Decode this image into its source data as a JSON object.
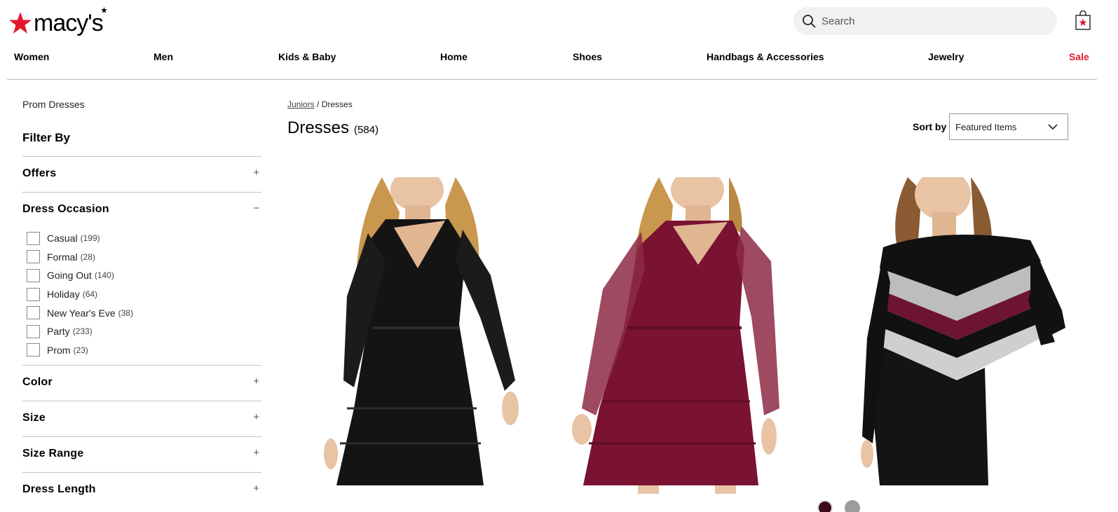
{
  "header": {
    "logo_text": "macy's",
    "search_placeholder": "Search"
  },
  "nav": [
    {
      "label": "Women"
    },
    {
      "label": "Men"
    },
    {
      "label": "Kids & Baby"
    },
    {
      "label": "Home"
    },
    {
      "label": "Shoes"
    },
    {
      "label": "Handbags & Accessories"
    },
    {
      "label": "Jewelry"
    },
    {
      "label": "Sale"
    }
  ],
  "sidebar": {
    "prom_link": "Prom Dresses",
    "filter_title": "Filter By",
    "facets": [
      {
        "title": "Offers",
        "toggle": "+"
      },
      {
        "title": "Dress Occasion",
        "toggle": "−"
      },
      {
        "title": "Color",
        "toggle": "+"
      },
      {
        "title": "Size",
        "toggle": "+"
      },
      {
        "title": "Size Range",
        "toggle": "+"
      },
      {
        "title": "Dress Length",
        "toggle": "+"
      }
    ],
    "occasion_options": [
      {
        "label": "Casual",
        "count": "(199)"
      },
      {
        "label": "Formal",
        "count": "(28)"
      },
      {
        "label": "Going Out",
        "count": "(140)"
      },
      {
        "label": "Holiday",
        "count": "(64)"
      },
      {
        "label": "New Year's Eve",
        "count": "(38)"
      },
      {
        "label": "Party",
        "count": "(233)"
      },
      {
        "label": "Prom",
        "count": "(23)"
      }
    ]
  },
  "main": {
    "breadcrumb": {
      "parent": "Juniors",
      "separator": "/",
      "current": "Dresses"
    },
    "title": "Dresses",
    "count": "(584)",
    "sort_label": "Sort by",
    "sort_value": "Featured Items"
  },
  "colors": {
    "brand_red": "#e21a2c",
    "sale_red": "#e21a2c",
    "search_bg": "#f1f1f1",
    "divider": "#c4c4c4",
    "dress_black": "#141414",
    "dress_burgundy": "#7a1232",
    "sweater_burgundy": "#6d1430",
    "sweater_grey": "#bdbdbd"
  }
}
